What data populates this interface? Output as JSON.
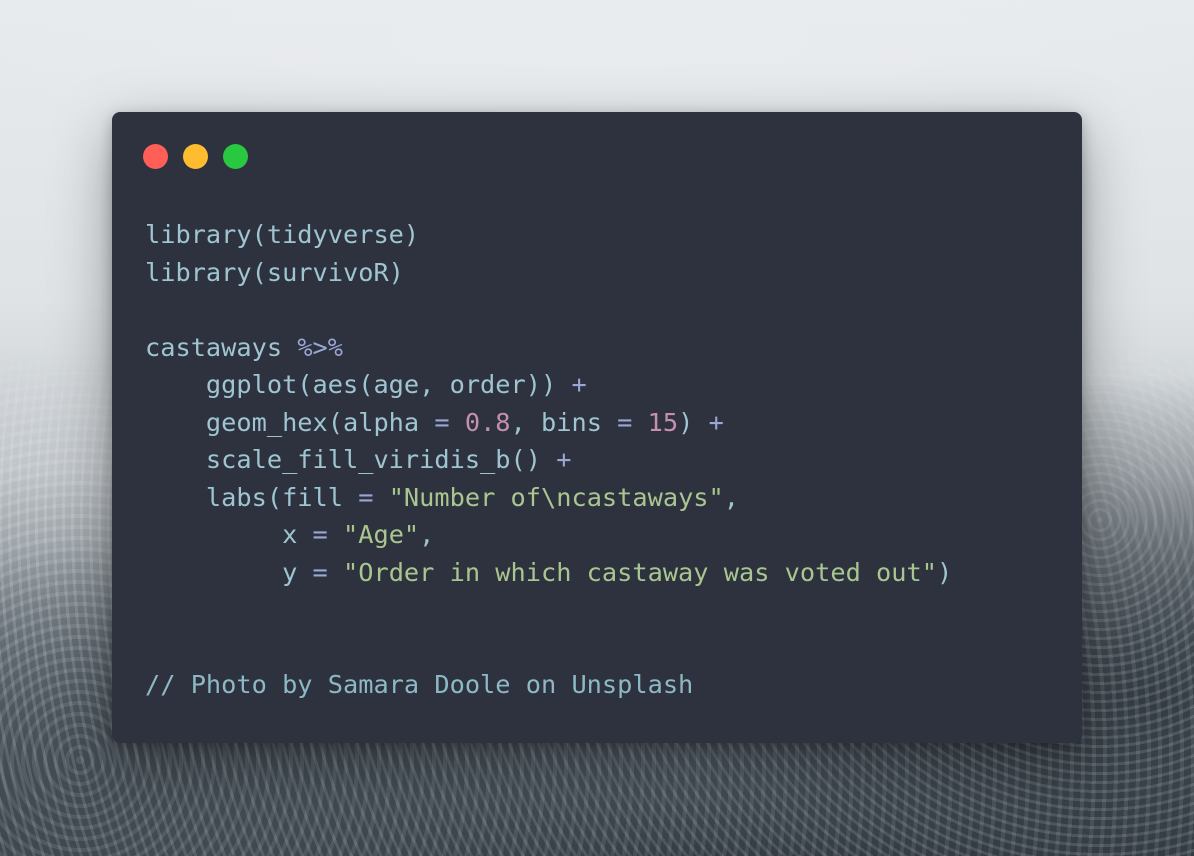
{
  "window": {
    "controls": [
      {
        "name": "close",
        "color": "#ff5f57"
      },
      {
        "name": "minimize",
        "color": "#febc2e"
      },
      {
        "name": "maximize",
        "color": "#28c840"
      }
    ]
  },
  "colors": {
    "background": "#2d323e",
    "text": "#9ec5d1",
    "string": "#a9c690",
    "number": "#c58fb0",
    "operator": "#9aa6d4"
  },
  "code_lines": [
    [
      {
        "t": "library(tidyverse)",
        "k": "txt"
      }
    ],
    [
      {
        "t": "library(survivoR)",
        "k": "txt"
      }
    ],
    [],
    [
      {
        "t": "castaways ",
        "k": "txt"
      },
      {
        "t": "%>%",
        "k": "op"
      }
    ],
    [
      {
        "t": "    ggplot(aes(age, order)) ",
        "k": "txt"
      },
      {
        "t": "+",
        "k": "op"
      }
    ],
    [
      {
        "t": "    geom_hex(alpha ",
        "k": "txt"
      },
      {
        "t": "=",
        "k": "op"
      },
      {
        "t": " ",
        "k": "txt"
      },
      {
        "t": "0.8",
        "k": "num"
      },
      {
        "t": ", bins ",
        "k": "txt"
      },
      {
        "t": "=",
        "k": "op"
      },
      {
        "t": " ",
        "k": "txt"
      },
      {
        "t": "15",
        "k": "num"
      },
      {
        "t": ") ",
        "k": "txt"
      },
      {
        "t": "+",
        "k": "op"
      }
    ],
    [
      {
        "t": "    scale_fill_viridis_b() ",
        "k": "txt"
      },
      {
        "t": "+",
        "k": "op"
      }
    ],
    [
      {
        "t": "    labs(fill ",
        "k": "txt"
      },
      {
        "t": "=",
        "k": "op"
      },
      {
        "t": " ",
        "k": "txt"
      },
      {
        "t": "\"Number of\\ncastaways\"",
        "k": "str"
      },
      {
        "t": ",",
        "k": "txt"
      }
    ],
    [
      {
        "t": "         x ",
        "k": "txt"
      },
      {
        "t": "=",
        "k": "op"
      },
      {
        "t": " ",
        "k": "txt"
      },
      {
        "t": "\"Age\"",
        "k": "str"
      },
      {
        "t": ",",
        "k": "txt"
      }
    ],
    [
      {
        "t": "         y ",
        "k": "txt"
      },
      {
        "t": "=",
        "k": "op"
      },
      {
        "t": " ",
        "k": "txt"
      },
      {
        "t": "\"Order in which castaway was voted out\"",
        "k": "str"
      },
      {
        "t": ")",
        "k": "txt"
      }
    ],
    [],
    [],
    [
      {
        "t": "// Photo by Samara Doole on Unsplash",
        "k": "com"
      }
    ]
  ]
}
